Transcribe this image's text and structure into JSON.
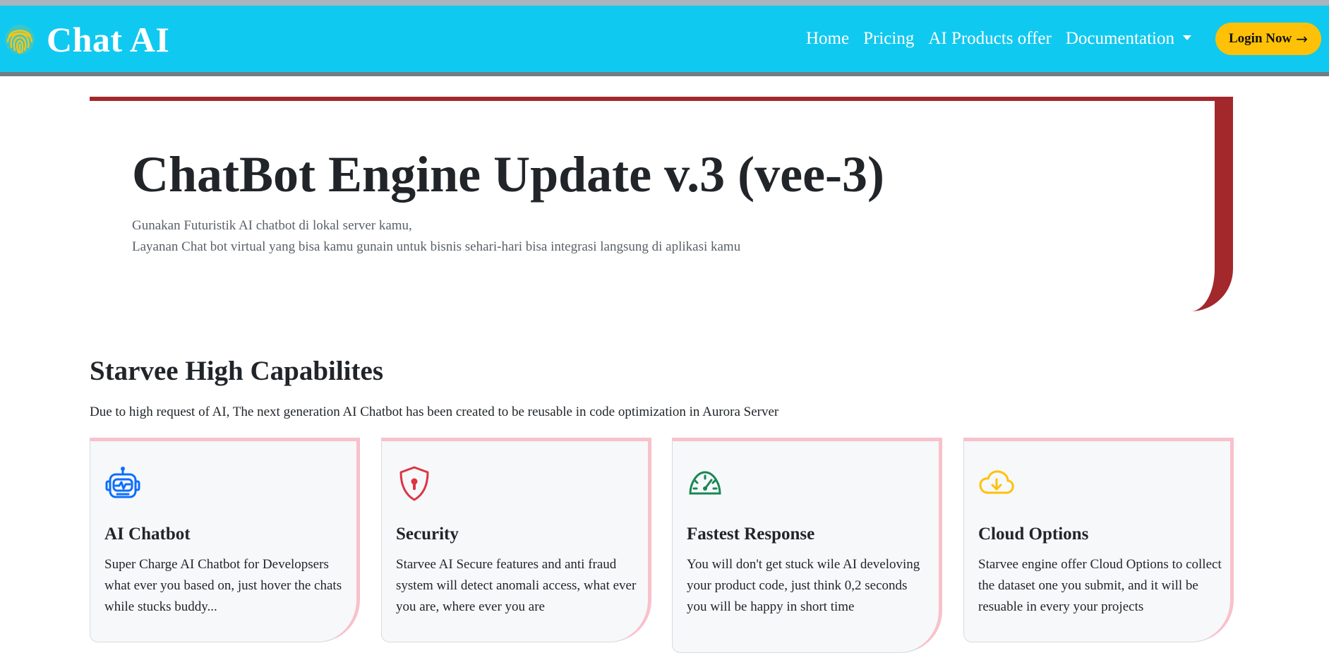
{
  "navbar": {
    "brand_name": "Chat AI",
    "brand_icon": "fingerprint-icon",
    "links": [
      "Home",
      "Pricing",
      "AI Products offer",
      "Documentation"
    ],
    "login_label": "Login Now",
    "login_icon": "arrow-right-icon",
    "background": "#10c9f0",
    "login_color": "#ffc107"
  },
  "hero": {
    "title": "ChatBot Engine Update v.3 (vee-3)",
    "subtitle_line1": "Gunakan Futuristik AI chatbot di lokal server kamu,",
    "subtitle_line2": "Layanan Chat bot virtual yang bisa kamu gunain untuk bisnis sehari-hari bisa integrasi langsung di aplikasi kamu",
    "accent": "#a3282b"
  },
  "capabilities": {
    "title": "Starvee High Capabilites",
    "description": "Due to high request of AI, The next generation AI Chatbot has been created to be reusable in code optimization in Aurora Server",
    "cards": [
      {
        "icon": "robot-icon",
        "icon_color": "#0d6efd",
        "title": "AI Chatbot",
        "text": "Super Charge AI Chatbot for Developsers what ever you based on, just hover the chats while stucks buddy..."
      },
      {
        "icon": "shield-lock-icon",
        "icon_color": "#dc3545",
        "title": "Security",
        "text": "Starvee AI Secure features and anti fraud system will detect anomali access, what ever you are, where ever you are"
      },
      {
        "icon": "speedometer-icon",
        "icon_color": "#198754",
        "title": "Fastest Response",
        "text": "You will don't get stuck wile AI develoving your product code, just think 0,2 seconds you will be happy in short time"
      },
      {
        "icon": "cloud-download-icon",
        "icon_color": "#ffc107",
        "title": "Cloud Options",
        "text": "Starvee engine offer Cloud Options to collect the dataset one you submit, and it will be resuable in every your projects"
      }
    ]
  }
}
